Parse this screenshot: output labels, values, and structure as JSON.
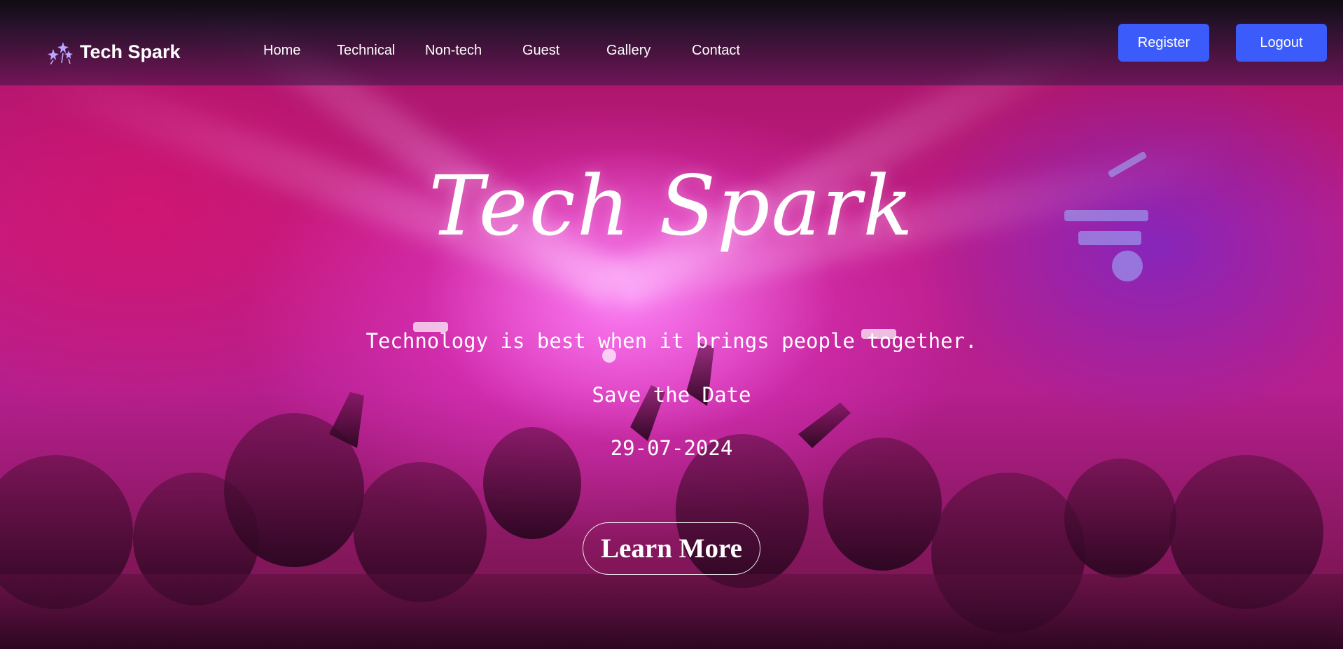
{
  "brand": {
    "name": "Tech Spark",
    "icon": "sparkle-stars-icon"
  },
  "nav": {
    "items": [
      {
        "label": "Home"
      },
      {
        "label": "Technical"
      },
      {
        "label": "Non-tech"
      },
      {
        "label": "Guest"
      },
      {
        "label": "Gallery"
      },
      {
        "label": "Contact"
      }
    ]
  },
  "actions": {
    "register_label": "Register",
    "logout_label": "Logout"
  },
  "hero": {
    "title": "Tech Spark",
    "tagline": "Technology is best when it brings people together.",
    "save_date_label": "Save the Date",
    "date": "29-07-2024",
    "cta_label": "Learn More"
  },
  "colors": {
    "button_accent": "#3b5bfa",
    "hero_tint": "#c01d86"
  }
}
